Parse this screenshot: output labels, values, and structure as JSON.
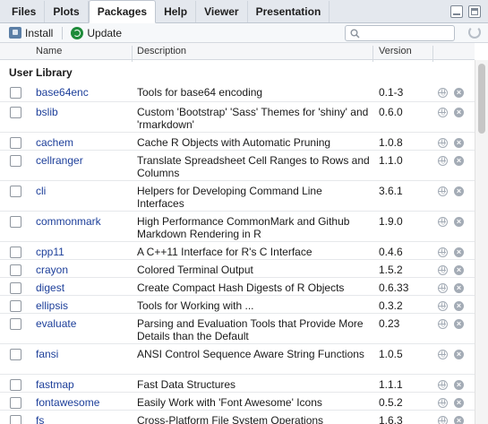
{
  "tabs": [
    "Files",
    "Plots",
    "Packages",
    "Help",
    "Viewer",
    "Presentation"
  ],
  "active_tab": "Packages",
  "toolbar": {
    "install_label": "Install",
    "update_label": "Update",
    "search_placeholder": ""
  },
  "table": {
    "headers": {
      "name": "Name",
      "description": "Description",
      "version": "Version"
    },
    "section_label": "User Library",
    "rows": [
      {
        "name": "base64enc",
        "description": "Tools for base64 encoding",
        "version": "0.1-3"
      },
      {
        "name": "bslib",
        "description": "Custom 'Bootstrap' 'Sass' Themes for 'shiny' and 'rmarkdown'",
        "version": "0.6.0"
      },
      {
        "name": "cachem",
        "description": "Cache R Objects with Automatic Pruning",
        "version": "1.0.8"
      },
      {
        "name": "cellranger",
        "description": "Translate Spreadsheet Cell Ranges to Rows and Columns",
        "version": "1.1.0"
      },
      {
        "name": "cli",
        "description": "Helpers for Developing Command Line Interfaces",
        "version": "3.6.1"
      },
      {
        "name": "commonmark",
        "description": "High Performance CommonMark and Github Markdown Rendering in R",
        "version": "1.9.0"
      },
      {
        "name": "cpp11",
        "description": "A C++11 Interface for R's C Interface",
        "version": "0.4.6"
      },
      {
        "name": "crayon",
        "description": "Colored Terminal Output",
        "version": "1.5.2"
      },
      {
        "name": "digest",
        "description": "Create Compact Hash Digests of R Objects",
        "version": "0.6.33"
      },
      {
        "name": "ellipsis",
        "description": "Tools for Working with ...",
        "version": "0.3.2"
      },
      {
        "name": "evaluate",
        "description": "Parsing and Evaluation Tools that Provide More Details than the Default",
        "version": "0.23"
      },
      {
        "name": "fansi",
        "description": "ANSI Control Sequence Aware String Functions",
        "version": "1.0.5"
      },
      {
        "name": "fastmap",
        "description": "Fast Data Structures",
        "version": "1.1.1"
      },
      {
        "name": "fontawesome",
        "description": "Easily Work with 'Font Awesome' Icons",
        "version": "0.5.2"
      },
      {
        "name": "fs",
        "description": "Cross-Platform File System Operations",
        "version": "1.6.3"
      }
    ]
  }
}
